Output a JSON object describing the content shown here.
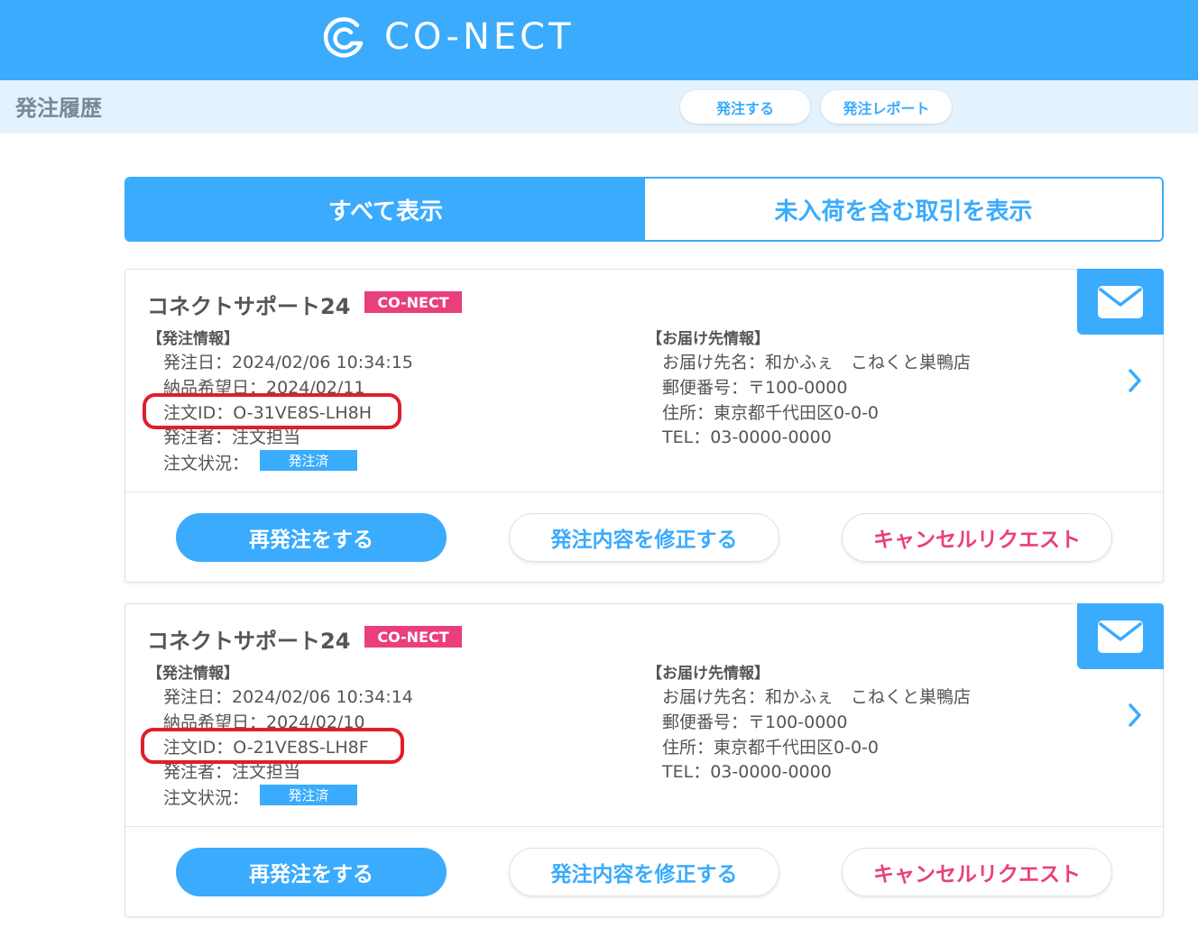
{
  "header": {
    "brand": "CO-NECT",
    "logo_icon": "conect-logo-icon"
  },
  "subheader": {
    "title": "発注履歴",
    "order_button": "発注する",
    "report_button": "発注レポート"
  },
  "tabs": {
    "all": "すべて表示",
    "pending": "未入荷を含む取引を表示",
    "active": "all"
  },
  "labels": {
    "order_section": "【発注情報】",
    "ship_section": "【お届け先情報】"
  },
  "orders": [
    {
      "shop": "コネクトサポート24",
      "badge": "CO-NECT",
      "order_date": "発注日：2024/02/06 10:34:15",
      "delivery_date": "納品希望日：2024/02/11",
      "order_id": "注文ID：O-31VE8S-LH8H",
      "orderer": "発注者：注文担当",
      "status_label": "注文状況：",
      "status": "発注済",
      "ship_name": "お届け先名：和かふぇ　こねくと巣鴨店",
      "postal": "郵便番号：〒100-0000",
      "address": "住所：東京都千代田区0-0-0",
      "tel": "TEL：03-0000-0000",
      "reorder_button": "再発注をする",
      "edit_button": "発注内容を修正する",
      "cancel_button": "キャンセルリクエスト"
    },
    {
      "shop": "コネクトサポート24",
      "badge": "CO-NECT",
      "order_date": "発注日：2024/02/06 10:34:14",
      "delivery_date": "納品希望日：2024/02/10",
      "order_id": "注文ID：O-21VE8S-LH8F",
      "orderer": "発注者：注文担当",
      "status_label": "注文状況：",
      "status": "発注済",
      "ship_name": "お届け先名：和かふぇ　こねくと巣鴨店",
      "postal": "郵便番号：〒100-0000",
      "address": "住所：東京都千代田区0-0-0",
      "tel": "TEL：03-0000-0000",
      "reorder_button": "再発注をする",
      "edit_button": "発注内容を修正する",
      "cancel_button": "キャンセルリクエスト"
    }
  ],
  "colors": {
    "primary": "#3aabfd",
    "accent_pink": "#ea3f7d",
    "annotation_red": "#e01e2b",
    "subheader_bg": "#e3f2fd"
  }
}
